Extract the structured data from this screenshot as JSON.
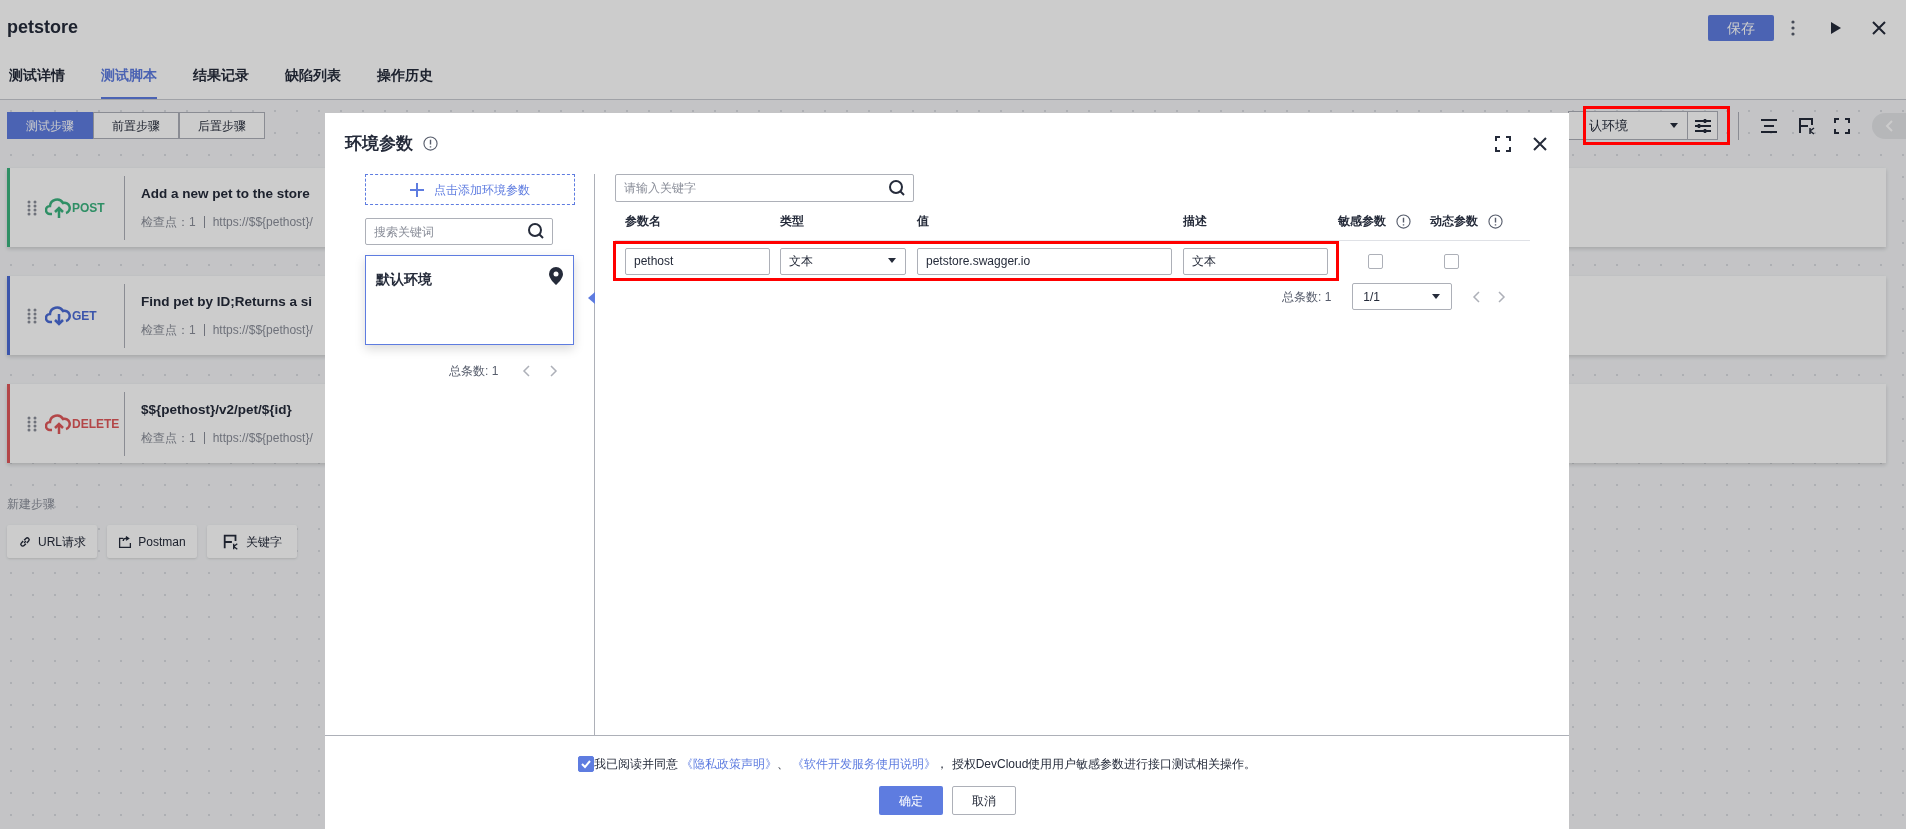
{
  "page": {
    "title": "petstore",
    "save_button": "保存"
  },
  "tabs": [
    {
      "label": "测试详情",
      "selected": false
    },
    {
      "label": "测试脚本",
      "selected": true
    },
    {
      "label": "结果记录",
      "selected": false
    },
    {
      "label": "缺陷列表",
      "selected": false
    },
    {
      "label": "操作历史",
      "selected": false
    }
  ],
  "step_tabs": [
    {
      "label": "测试步骤",
      "selected": true
    },
    {
      "label": "前置步骤",
      "selected": false
    },
    {
      "label": "后置步骤",
      "selected": false
    }
  ],
  "steps": [
    {
      "kind": "post",
      "method": "POST",
      "title": "Add a new pet to the store",
      "checkpoint": "检查点：1",
      "url": "https://$${pethost}/"
    },
    {
      "kind": "get",
      "method": "GET",
      "title": "Find pet by ID;Returns a si",
      "checkpoint": "检查点：1",
      "url": "https://$${pethost}/"
    },
    {
      "kind": "delete",
      "method": "DELETE",
      "title": "$${pethost}/v2/pet/${id}",
      "checkpoint": "检查点：1",
      "url": "https://$${pethost}/"
    }
  ],
  "new_step": {
    "label": "新建步骤",
    "buttons": [
      {
        "kind": "url",
        "label": "URL请求"
      },
      {
        "kind": "postman",
        "label": "Postman"
      },
      {
        "kind": "keyword",
        "label": "关键字"
      }
    ]
  },
  "environment_select": {
    "value": "认环境"
  },
  "modal": {
    "title": "环境参数",
    "add_button": "点击添加环境参数",
    "env_search": {
      "placeholder": "搜索关键词"
    },
    "environments": [
      {
        "name": "默认环境",
        "selected": true
      }
    ],
    "env_total": "总条数: 1",
    "param_search": {
      "placeholder": "请输入关键字"
    },
    "columns": [
      {
        "kind": "plain",
        "label": "参数名"
      },
      {
        "kind": "plain",
        "label": "类型"
      },
      {
        "kind": "plain",
        "label": "值"
      },
      {
        "kind": "plain",
        "label": "描述"
      },
      {
        "kind": "info",
        "label": "敏感参数"
      },
      {
        "kind": "info",
        "label": "动态参数"
      }
    ],
    "rows": [
      {
        "name": "pethost",
        "type": "文本",
        "value": "petstore.swagger.io",
        "description": "文本",
        "sensitive": false,
        "dynamic": false
      }
    ],
    "total": "总条数: 1",
    "page": "1/1",
    "consent": {
      "checked": true,
      "parts": [
        {
          "kind": "text",
          "text": "我已阅读并同意 "
        },
        {
          "kind": "link",
          "text": "《隐私政策声明》"
        },
        {
          "kind": "text",
          "text": "、 "
        },
        {
          "kind": "link",
          "text": "《软件开发服务使用说明》"
        },
        {
          "kind": "text",
          "text": "， 授权DevCloud使用用户敏感参数进行接口测试相关操作。"
        }
      ]
    },
    "ok_button": "确定",
    "cancel_button": "取消"
  }
}
